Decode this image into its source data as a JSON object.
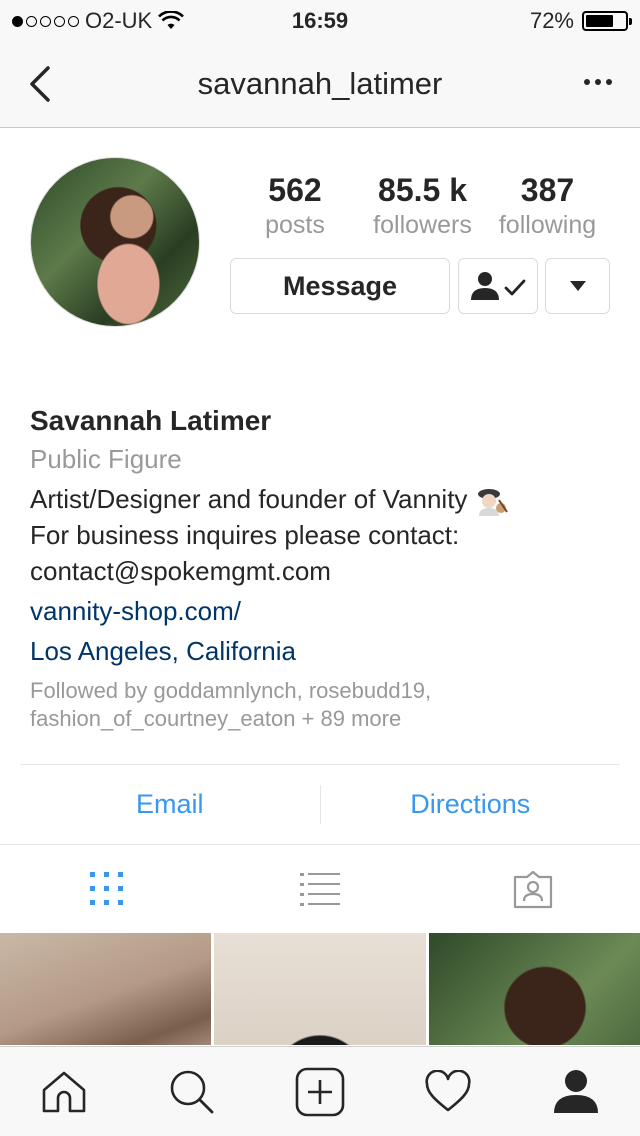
{
  "status_bar": {
    "carrier": "O2-UK",
    "time": "16:59",
    "battery_percent": "72%",
    "battery_level": 0.72
  },
  "nav": {
    "title": "savannah_latimer"
  },
  "stats": {
    "posts": {
      "value": "562",
      "label": "posts"
    },
    "followers": {
      "value": "85.5 k",
      "label": "followers"
    },
    "following": {
      "value": "387",
      "label": "following"
    }
  },
  "actions": {
    "message_label": "Message"
  },
  "bio": {
    "name": "Savannah Latimer",
    "category": "Public Figure",
    "line1": "Artist/Designer and founder of Vannity",
    "line2": "For business inquires please contact:",
    "line3": "contact@spokemgmt.com",
    "website": "vannity-shop.com/",
    "location": "Los Angeles, California",
    "followed_by": "Followed by goddamnlynch, rosebudd19, fashion_of_courtney_eaton + 89 more"
  },
  "contact": {
    "email_label": "Email",
    "directions_label": "Directions"
  },
  "colors": {
    "accent": "#3897f0",
    "link": "#003569",
    "muted": "#999999"
  }
}
